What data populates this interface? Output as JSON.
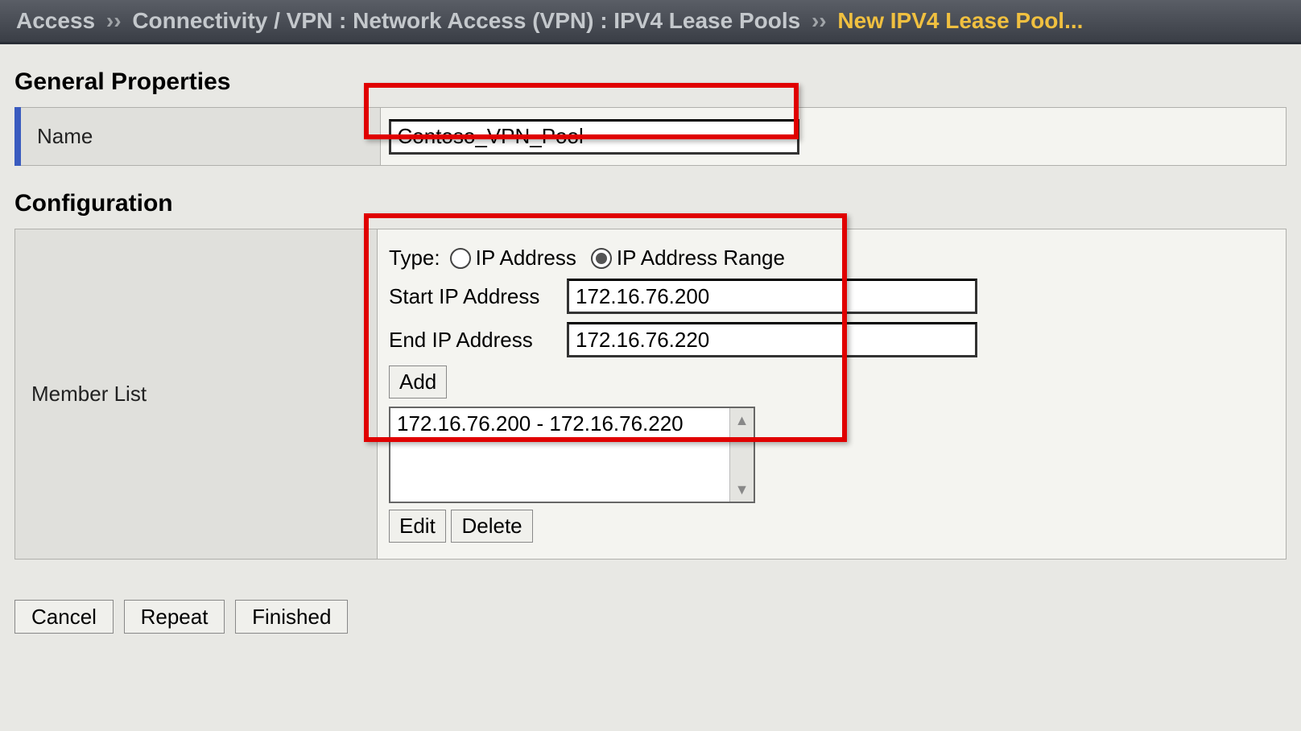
{
  "breadcrumb": {
    "level1": "Access",
    "sep": "››",
    "level2": "Connectivity / VPN : Network Access (VPN) : IPV4 Lease Pools",
    "current": "New IPV4 Lease Pool..."
  },
  "general": {
    "title": "General Properties",
    "name_label": "Name",
    "name_value": "Contoso_VPN_Pool"
  },
  "config": {
    "title": "Configuration",
    "member_list_label": "Member List",
    "type_label": "Type:",
    "radio_ip_address": "IP Address",
    "radio_ip_range": "IP Address Range",
    "start_ip_label": "Start IP Address",
    "start_ip_value": "172.16.76.200",
    "end_ip_label": "End IP Address",
    "end_ip_value": "172.16.76.220",
    "add_label": "Add",
    "list_items": [
      "172.16.76.200 - 172.16.76.220"
    ],
    "edit_label": "Edit",
    "delete_label": "Delete"
  },
  "footer": {
    "cancel": "Cancel",
    "repeat": "Repeat",
    "finished": "Finished"
  }
}
